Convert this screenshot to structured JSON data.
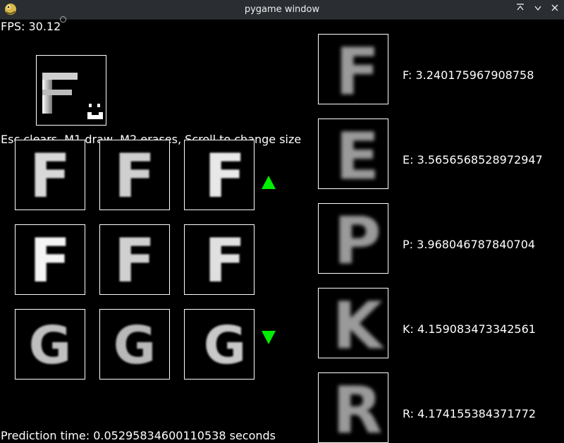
{
  "window": {
    "title": "pygame window"
  },
  "overlay": {
    "fps": "FPS: 30.12",
    "instructions": "Esc clears, M1 draw, M2 erases, Scroll to change size",
    "prediction_time": "Prediction time: 0.05295834600110538 seconds"
  },
  "drawn_letter": "F",
  "samples": [
    {
      "letter": "F"
    },
    {
      "letter": "F"
    },
    {
      "letter": "F"
    },
    {
      "letter": "F"
    },
    {
      "letter": "F"
    },
    {
      "letter": "F"
    },
    {
      "letter": "G"
    },
    {
      "letter": "G"
    },
    {
      "letter": "G"
    }
  ],
  "predictions": [
    {
      "letter": "F",
      "label": "F: 3.240175967908758"
    },
    {
      "letter": "E",
      "label": "E: 3.5656568528972947"
    },
    {
      "letter": "P",
      "label": "P: 3.968046787840704"
    },
    {
      "letter": "K",
      "label": "K: 4.159083473342561"
    },
    {
      "letter": "R",
      "label": "R: 4.174155384371772"
    }
  ],
  "colors": {
    "accent": "#00ee00",
    "background": "#000000",
    "titlebar": "#2a2e32"
  }
}
